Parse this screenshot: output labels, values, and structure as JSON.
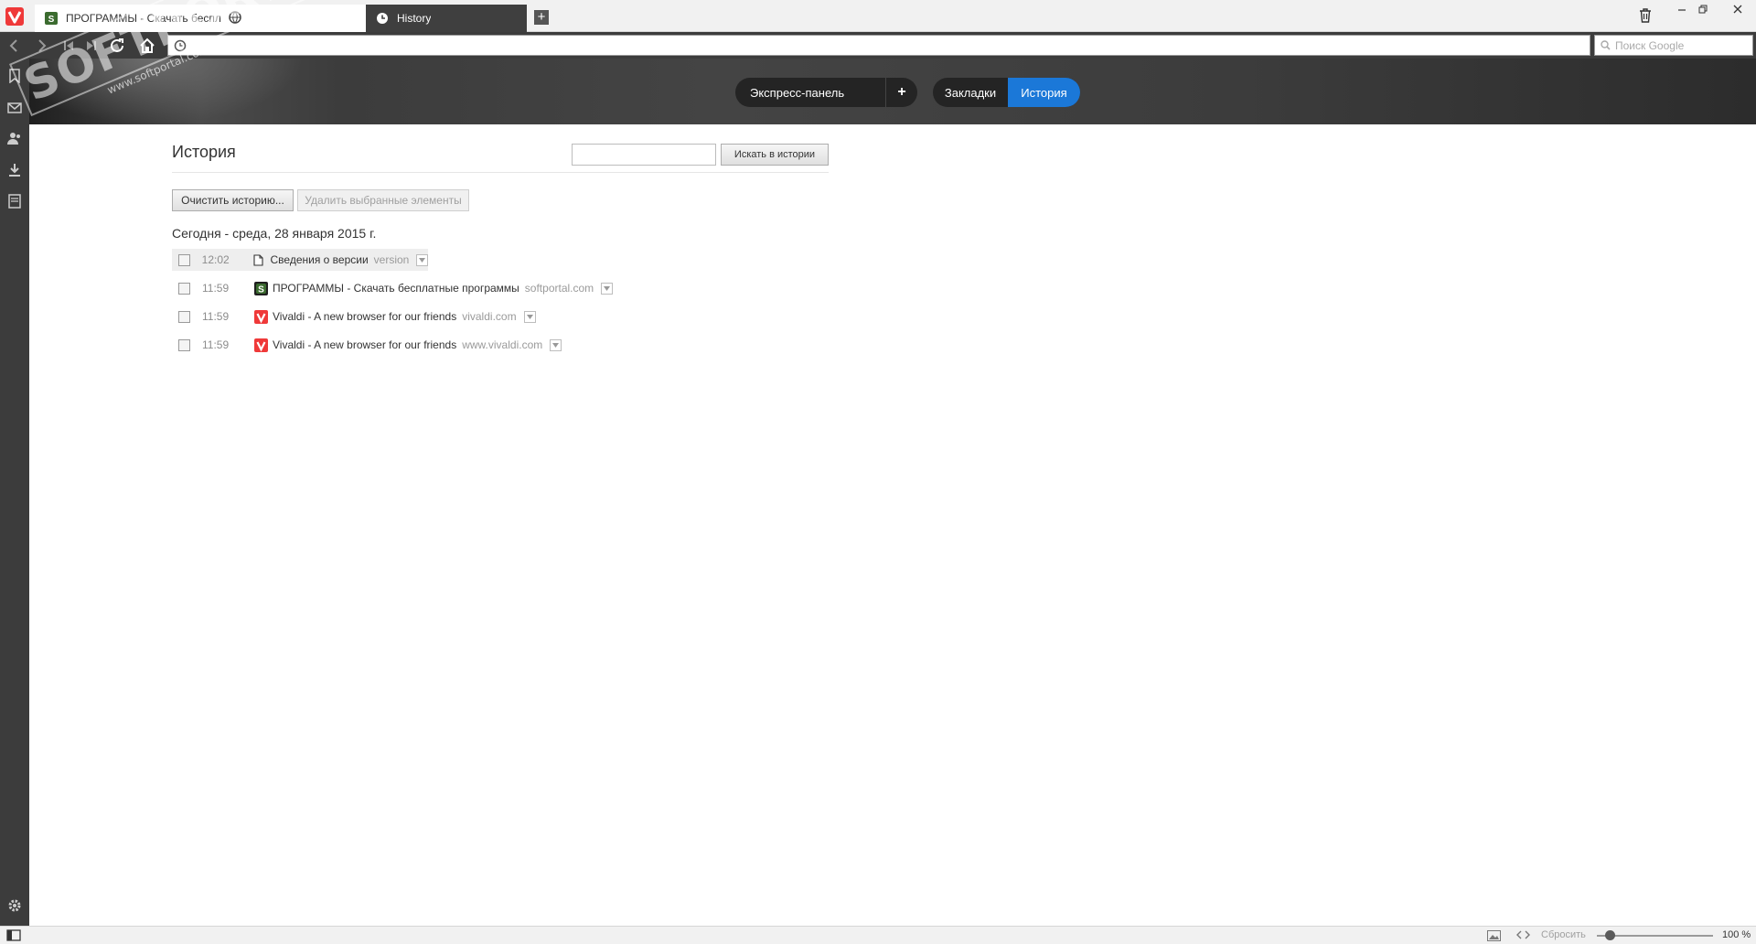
{
  "tabs": [
    {
      "title": "ПРОГРАММЫ - Скачать бесплатные программы",
      "active": false,
      "favicon": "softportal-s-icon"
    },
    {
      "title": "History",
      "active": true,
      "favicon": "clock-icon"
    }
  ],
  "new_tab_label": "+",
  "address_bar": {
    "url": "",
    "search_placeholder": "Поиск Google"
  },
  "header_nav": {
    "speed_dial": "Экспресс-панель",
    "add": "+",
    "bookmarks": "Закладки",
    "history": "История"
  },
  "history_page": {
    "title": "История",
    "search_input_value": "",
    "search_button": "Искать в истории",
    "clear_button": "Очистить историю...",
    "delete_button": "Удалить выбранные элементы",
    "date_heading": "Сегодня - среда, 28 января 2015 г.",
    "entries": [
      {
        "time": "12:02",
        "title": "Сведения о версии",
        "domain": "version",
        "icon": "page-icon",
        "highlighted": true
      },
      {
        "time": "11:59",
        "title": "ПРОГРАММЫ - Скачать бесплатные программы",
        "domain": "softportal.com",
        "icon": "softportal-icon",
        "highlighted": false
      },
      {
        "time": "11:59",
        "title": "Vivaldi - A new browser for our friends",
        "domain": "vivaldi.com",
        "icon": "vivaldi-icon",
        "highlighted": false
      },
      {
        "time": "11:59",
        "title": "Vivaldi - A new browser for our friends",
        "domain": "www.vivaldi.com",
        "icon": "vivaldi-icon",
        "highlighted": false
      }
    ]
  },
  "statusbar": {
    "reset": "Сбросить",
    "zoom": "100 %",
    "zoom_value_percent": 100
  },
  "watermark": {
    "main": "SOFTPORTAL",
    "sub": "www.softportal.com"
  },
  "colors": {
    "accent": "#1b78d8",
    "chrome_dark": "#3c3c3c",
    "vivaldi_red": "#ef3939"
  }
}
